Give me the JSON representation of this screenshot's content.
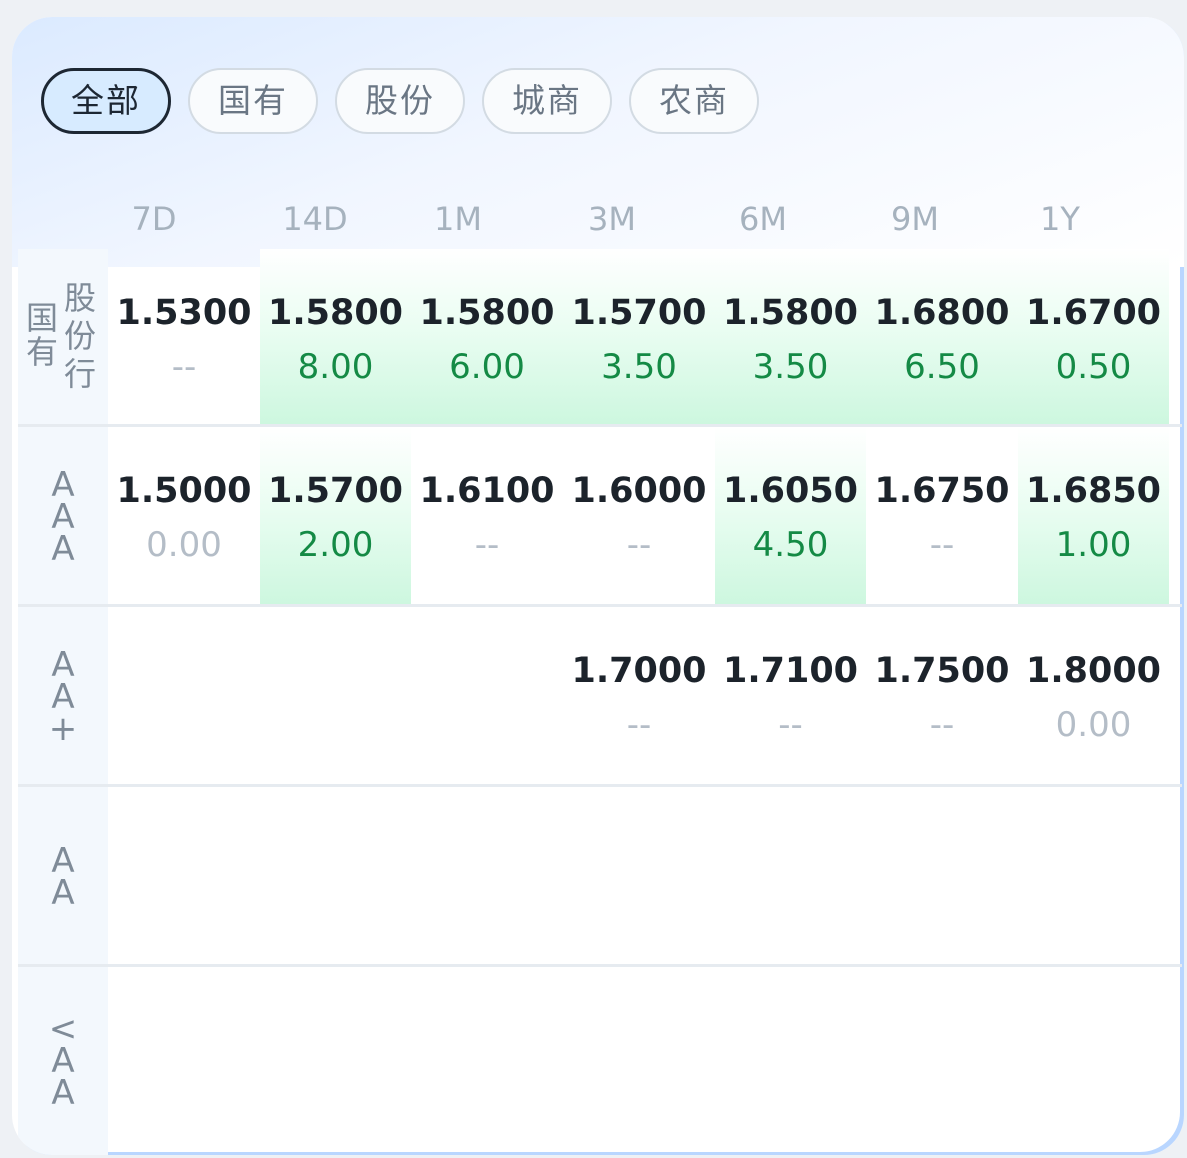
{
  "tabs": [
    "全部",
    "国有",
    "股份",
    "城商",
    "农商"
  ],
  "active_tab": "全部",
  "columns": [
    "7D",
    "14D",
    "1M",
    "3M",
    "6M",
    "9M",
    "1Y"
  ],
  "rows": [
    {
      "label_a": "国有",
      "label_b": "股份行",
      "cells": [
        {
          "rate": "1.5300",
          "chg": "--",
          "up": false,
          "hl": false
        },
        {
          "rate": "1.5800",
          "chg": "8.00",
          "up": true,
          "hl": true
        },
        {
          "rate": "1.5800",
          "chg": "6.00",
          "up": true,
          "hl": true
        },
        {
          "rate": "1.5700",
          "chg": "3.50",
          "up": true,
          "hl": true
        },
        {
          "rate": "1.5800",
          "chg": "3.50",
          "up": true,
          "hl": true
        },
        {
          "rate": "1.6800",
          "chg": "6.50",
          "up": true,
          "hl": true
        },
        {
          "rate": "1.6700",
          "chg": "0.50",
          "up": true,
          "hl": true
        }
      ]
    },
    {
      "label": "AAA",
      "cells": [
        {
          "rate": "1.5000",
          "chg": "0.00",
          "up": false,
          "hl": false
        },
        {
          "rate": "1.5700",
          "chg": "2.00",
          "up": true,
          "hl": true
        },
        {
          "rate": "1.6100",
          "chg": "--",
          "up": false,
          "hl": false
        },
        {
          "rate": "1.6000",
          "chg": "--",
          "up": false,
          "hl": false
        },
        {
          "rate": "1.6050",
          "chg": "4.50",
          "up": true,
          "hl": true
        },
        {
          "rate": "1.6750",
          "chg": "--",
          "up": false,
          "hl": false
        },
        {
          "rate": "1.6850",
          "chg": "1.00",
          "up": true,
          "hl": true
        }
      ]
    },
    {
      "label": "AA+",
      "cells": [
        null,
        null,
        null,
        {
          "rate": "1.7000",
          "chg": "--",
          "up": false,
          "hl": false
        },
        {
          "rate": "1.7100",
          "chg": "--",
          "up": false,
          "hl": false
        },
        {
          "rate": "1.7500",
          "chg": "--",
          "up": false,
          "hl": false
        },
        {
          "rate": "1.8000",
          "chg": "0.00",
          "up": false,
          "hl": false
        }
      ]
    },
    {
      "label": "AA",
      "cells": [
        null,
        null,
        null,
        null,
        null,
        null,
        null
      ]
    },
    {
      "label": "<AA",
      "cells": [
        null,
        null,
        null,
        null,
        null,
        null,
        null
      ]
    }
  ]
}
